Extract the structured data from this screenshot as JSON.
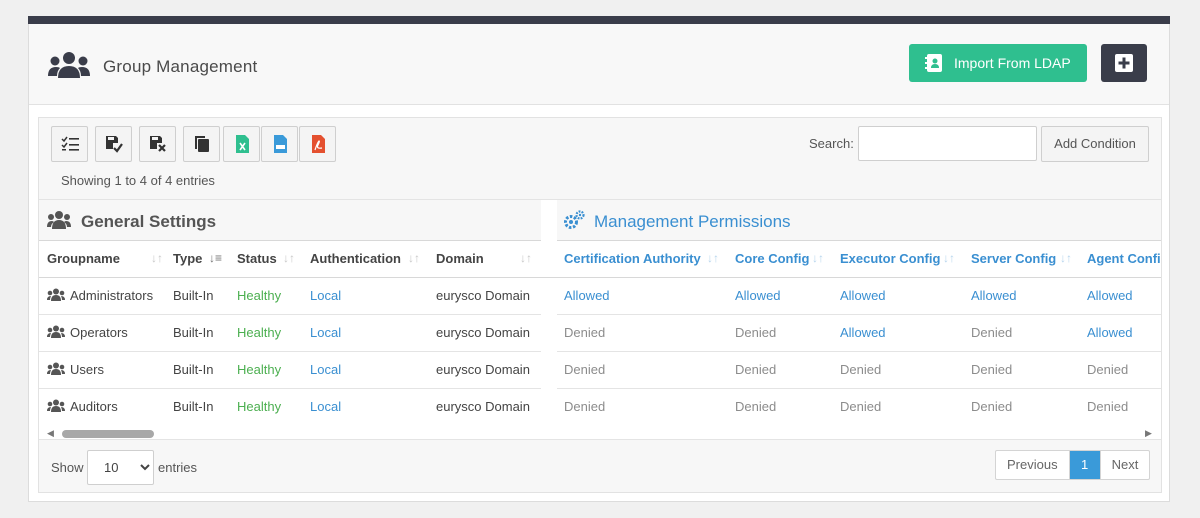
{
  "header": {
    "title": "Group Management",
    "import_label": "Import From LDAP",
    "add_icon": "plus-square-icon",
    "title_icon": "users-icon"
  },
  "toolbar": {
    "buttons": [
      "select-all-icon",
      "save-view-icon",
      "reset-view-icon",
      "copy-icon",
      "excel-export-icon",
      "csv-export-icon",
      "pdf-export-icon"
    ],
    "showing": "Showing 1 to 4 of 4 entries",
    "search_label": "Search:",
    "search_value": "",
    "add_condition_label": "Add Condition"
  },
  "groups": {
    "general": "General Settings",
    "permissions": "Management Permissions"
  },
  "columns": [
    "Groupname",
    "Type",
    "Status",
    "Authentication",
    "Domain",
    "Certification Authority",
    "Core Config",
    "Executor Config",
    "Server Config",
    "Agent Config"
  ],
  "rows": [
    {
      "name": "Administrators",
      "type": "Built-In",
      "status": "Healthy",
      "auth": "Local",
      "domain": "eurysco Domain",
      "perms": [
        "Allowed",
        "Allowed",
        "Allowed",
        "Allowed",
        "Allowed"
      ]
    },
    {
      "name": "Operators",
      "type": "Built-In",
      "status": "Healthy",
      "auth": "Local",
      "domain": "eurysco Domain",
      "perms": [
        "Denied",
        "Denied",
        "Allowed",
        "Denied",
        "Allowed"
      ]
    },
    {
      "name": "Users",
      "type": "Built-In",
      "status": "Healthy",
      "auth": "Local",
      "domain": "eurysco Domain",
      "perms": [
        "Denied",
        "Denied",
        "Denied",
        "Denied",
        "Denied"
      ]
    },
    {
      "name": "Auditors",
      "type": "Built-In",
      "status": "Healthy",
      "auth": "Local",
      "domain": "eurysco Domain",
      "perms": [
        "Denied",
        "Denied",
        "Denied",
        "Denied",
        "Denied"
      ]
    }
  ],
  "footer": {
    "show_label": "Show",
    "page_size": "10",
    "entries_label": "entries",
    "previous": "Previous",
    "current_page": "1",
    "next": "Next"
  },
  "colors": {
    "accent_green": "#2fbf8f",
    "dark": "#3a3d4a",
    "link_blue": "#3a8fd1",
    "healthy_green": "#4caf50"
  }
}
